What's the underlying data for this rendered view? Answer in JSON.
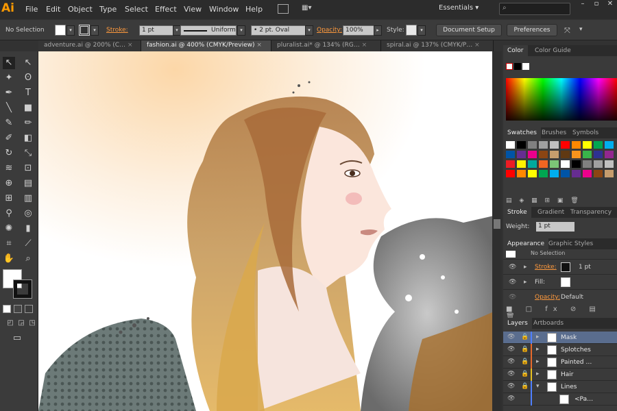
{
  "app": {
    "logo": "Ai"
  },
  "menu": [
    "File",
    "Edit",
    "Object",
    "Type",
    "Select",
    "Effect",
    "View",
    "Window",
    "Help"
  ],
  "workspace": "Essentials",
  "control": {
    "selection": "No Selection",
    "stroke_label": "Stroke:",
    "stroke_weight": "1 pt",
    "profile": "Uniform",
    "brush": "2 pt. Oval",
    "opacity_label": "Opacity:",
    "opacity": "100%",
    "style_label": "Style:",
    "document_setup": "Document Setup",
    "preferences": "Preferences"
  },
  "doc_tabs": [
    "adventure.ai @ 200% (C…",
    "fashion.ai @ 400% (CMYK/Preview)",
    "pluralist.ai* @ 134% (RG…",
    "spiral.ai @ 137% (CMYK/P…"
  ],
  "panels": {
    "color_tabs": [
      "Color",
      "Color Guide"
    ],
    "swatch_tabs": [
      "Swatches",
      "Brushes",
      "Symbols"
    ],
    "stroke_tabs": [
      "Stroke",
      "Gradient",
      "Transparency"
    ],
    "weight_label": "Weight:",
    "weight_value": "1 pt",
    "appearance_tabs": [
      "Appearance",
      "Graphic Styles"
    ],
    "appearance": {
      "header": "No Selection",
      "stroke_label": "Stroke:",
      "stroke_value": "1 pt",
      "fill_label": "Fill:",
      "opacity_label": "Opacity:",
      "opacity_value": "Default"
    },
    "layer_tabs": [
      "Layers",
      "Artboards"
    ],
    "layers": [
      "Mask",
      "Splotches",
      "Painted …",
      "Hair",
      "Lines",
      "<Pa…"
    ]
  },
  "colors": {
    "accent": "#ff9a00",
    "selected_layer": "#5a6d8e",
    "swatches": [
      "#ffffff",
      "#000000",
      "#808080",
      "#a0a0a0",
      "#c0c0c0",
      "#ff0000",
      "#ff8800",
      "#ffff00",
      "#00a651",
      "#00aeef",
      "#0054a6",
      "#662d91",
      "#ec008c",
      "#8b4513",
      "#c69c6d",
      "#603913",
      "#f7941d",
      "#39b54a",
      "#2e3192",
      "#92278f",
      "#ed1c24",
      "#fff200",
      "#00a99d",
      "#f26522",
      "#7cc576"
    ]
  }
}
